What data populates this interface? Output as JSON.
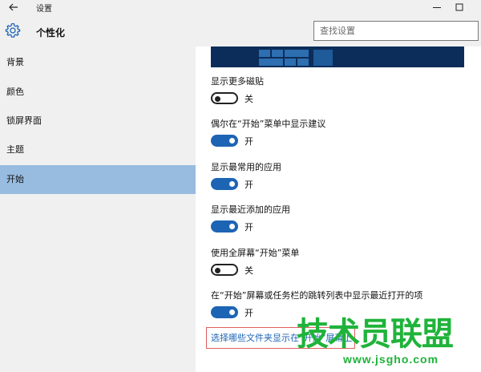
{
  "window": {
    "title": "设置",
    "back_icon": "back-arrow-icon",
    "minimize_icon": "minimize-icon",
    "maximize_icon": "maximize-icon"
  },
  "header": {
    "title": "个性化",
    "icon": "gear-icon",
    "search_placeholder": "查找设置"
  },
  "sidebar": {
    "items": [
      {
        "label": "背景"
      },
      {
        "label": "颜色"
      },
      {
        "label": "锁屏界面"
      },
      {
        "label": "主题"
      },
      {
        "label": "开始",
        "selected": true
      }
    ],
    "selected_color": "#98bce0"
  },
  "main": {
    "settings": [
      {
        "label": "显示更多磁贴",
        "state": "关",
        "on": false
      },
      {
        "label": "偶尔在“开始”菜单中显示建议",
        "state": "开",
        "on": true
      },
      {
        "label": "显示最常用的应用",
        "state": "开",
        "on": true
      },
      {
        "label": "显示最近添加的应用",
        "state": "开",
        "on": true
      },
      {
        "label": "使用全屏幕“开始”菜单",
        "state": "关",
        "on": false
      },
      {
        "label": "在“开始”屏幕或任务栏的跳转列表中显示最近打开的项",
        "state": "开",
        "on": true
      }
    ],
    "folder_link": "选择哪些文件夹显示在“开始”屏幕上",
    "toggle_on_color": "#1d64b5",
    "link_color": "#1d64b5"
  },
  "watermark": {
    "brand": "技术员联盟",
    "url": "www.jsgho.com",
    "color": "#1fb33a"
  }
}
